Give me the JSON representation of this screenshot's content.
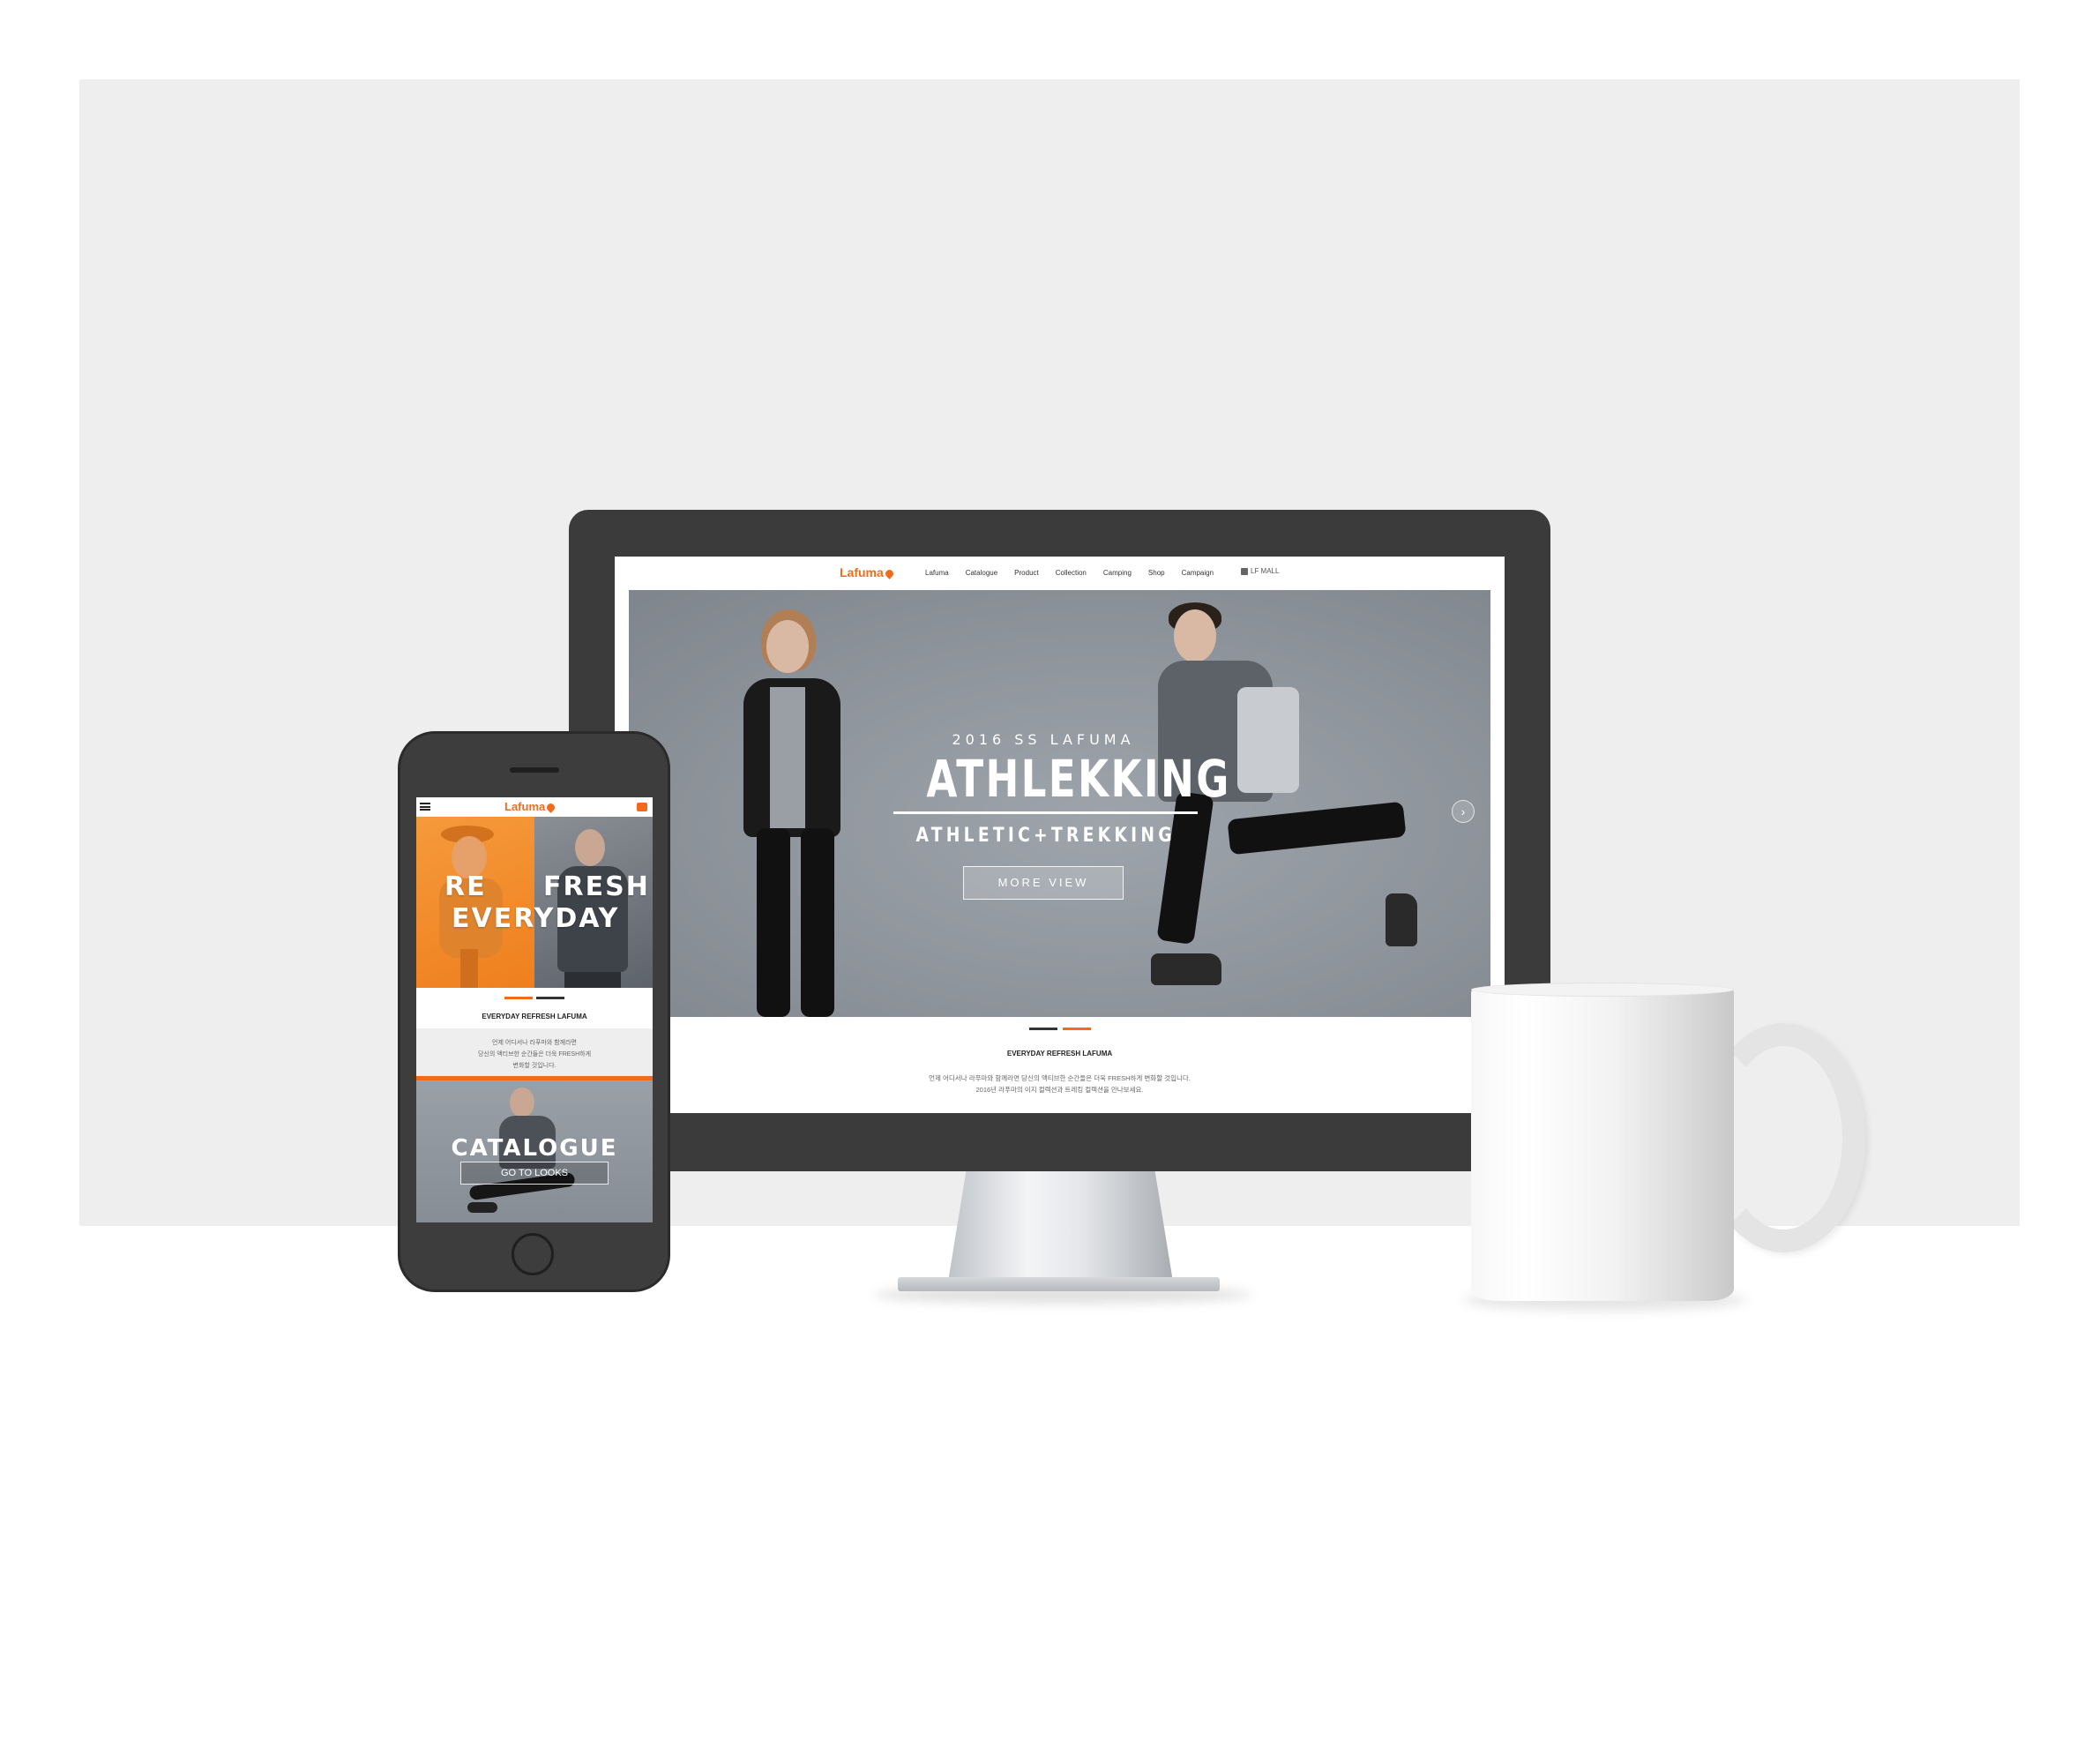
{
  "desktop": {
    "nav": {
      "logo": "Lafuma",
      "items": [
        "Lafuma",
        "Catalogue",
        "Product",
        "Collection",
        "Camping",
        "Shop",
        "Campaign"
      ],
      "lf_mall": "LF MALL"
    },
    "hero": {
      "subtitle": "2016 SS LAFUMA",
      "title": "ATHLEKKING",
      "tagline": "ATHLETIC+TREKKING",
      "button": "MORE VIEW",
      "next_arrow": "›"
    },
    "section": {
      "title": "EVERYDAY REFRESH LAFUMA",
      "line1": "언제 어디서나 라푸마와 함께라면 당신의 액티브한 순간들은 더욱 FRESH하게 변화할 것입니다.",
      "line2": "2016년 라푸마의 이지 컬렉션과 트레킹 컬렉션을 만나보세요."
    }
  },
  "mobile": {
    "logo": "Lafuma",
    "hero": {
      "word_re": "RE",
      "word_fresh": "FRESH",
      "word_everyday": "EVERYDAY"
    },
    "section": {
      "title": "EVERYDAY REFRESH LAFUMA",
      "line1": "언제 어디서나 라푸마와 함께라면",
      "line2": "당신의 액티브한 순간들은 더욱 FRESH하게",
      "line3": "변화할 것입니다."
    },
    "catalogue": {
      "title": "CATALOGUE",
      "button": "GO TO LOOKS"
    }
  },
  "colors": {
    "brand_orange": "#f26b1d",
    "device_dark": "#3b3b3b",
    "backdrop": "#eeeeee"
  }
}
